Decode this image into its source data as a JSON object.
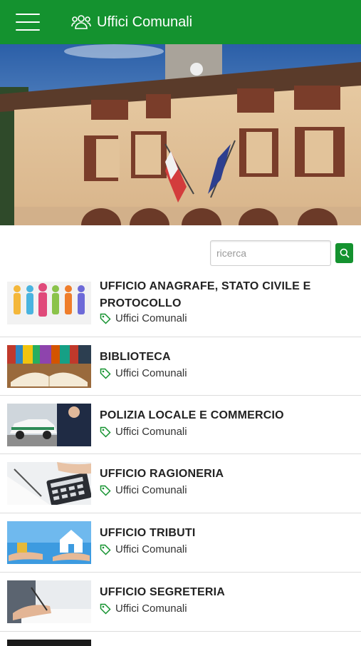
{
  "header": {
    "title": "Uffici Comunali",
    "menu_icon": "hamburger-menu-icon",
    "title_icon": "people-group-icon",
    "color": "#14922f"
  },
  "search": {
    "placeholder": "ricerca"
  },
  "items": [
    {
      "title": "UFFICIO ANAGRAFE, STATO CIVILE E PROTOCOLLO",
      "tag": "Uffici Comunali",
      "thumb": "people-figures-image"
    },
    {
      "title": "BIBLIOTECA",
      "tag": "Uffici Comunali",
      "thumb": "open-book-image"
    },
    {
      "title": "POLIZIA LOCALE E COMMERCIO",
      "tag": "Uffici Comunali",
      "thumb": "police-car-image"
    },
    {
      "title": "UFFICIO RAGIONERIA",
      "tag": "Uffici Comunali",
      "thumb": "calculator-image"
    },
    {
      "title": "UFFICIO TRIBUTI",
      "tag": "Uffici Comunali",
      "thumb": "house-coins-image"
    },
    {
      "title": "UFFICIO SEGRETERIA",
      "tag": "Uffici Comunali",
      "thumb": "writing-hand-image"
    }
  ]
}
